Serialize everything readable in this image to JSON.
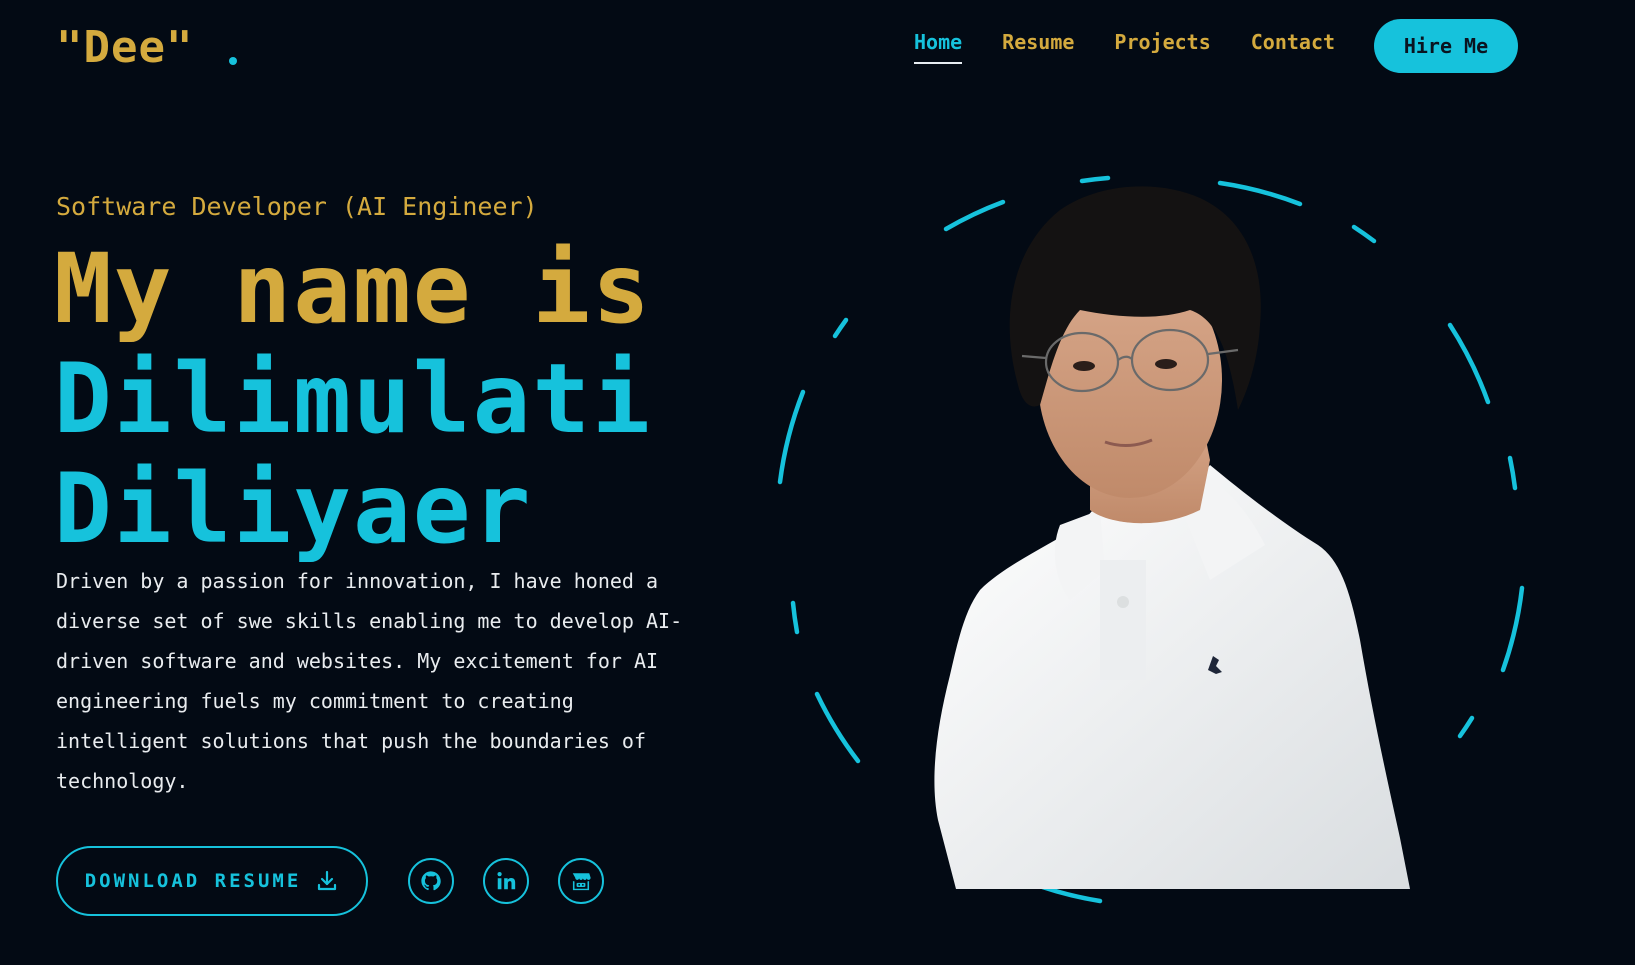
{
  "header": {
    "logo_text": "\"Dee\"",
    "nav": [
      {
        "label": "Home",
        "active": true
      },
      {
        "label": "Resume",
        "active": false
      },
      {
        "label": "Projects",
        "active": false
      },
      {
        "label": "Contact",
        "active": false
      }
    ],
    "hire_label": "Hire Me"
  },
  "hero": {
    "subtitle": "Software Developer (AI Engineer)",
    "headline_line1": "My name is",
    "headline_line2": "Dilimulati",
    "headline_line3": "Diliyaer",
    "bio": "Driven by a passion for innovation, I have honed a diverse set of swe skills enabling me to develop AI-driven software and websites. My excitement for AI engineering fuels my commitment to creating intelligent solutions that push the boundaries of technology.",
    "download_label": "DOWNLOAD RESUME",
    "socials": [
      {
        "icon": "github-icon"
      },
      {
        "icon": "linkedin-icon"
      },
      {
        "icon": "itch-icon"
      }
    ]
  },
  "colors": {
    "background": "#030a14",
    "gold": "#d4aa3e",
    "cyan": "#16c2dc",
    "text": "#e9ecef"
  }
}
